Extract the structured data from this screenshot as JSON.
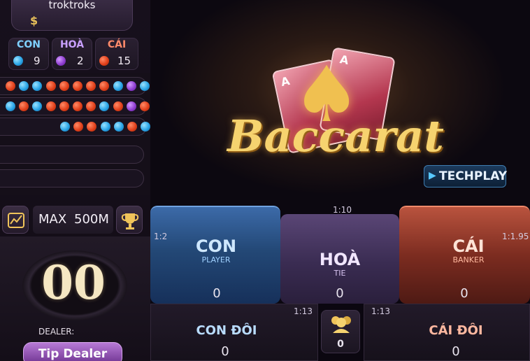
{
  "player": {
    "username": "troktroks",
    "currency_symbol": "$"
  },
  "stats": [
    {
      "label": "CON",
      "count": "9",
      "color": "#2aa5e7",
      "label_color": "#7fd0ff"
    },
    {
      "label": "HOÀ",
      "count": "2",
      "color": "#9140d2",
      "label_color": "#c9a0ff"
    },
    {
      "label": "CÁI",
      "count": "15",
      "color": "#e2411c",
      "label_color": "#ff8a6a"
    }
  ],
  "road": {
    "row1": [
      "red",
      "blue",
      "blue",
      "red",
      "red",
      "red",
      "red",
      "red",
      "blue",
      "purple",
      "blue"
    ],
    "row2": [
      "blue",
      "red",
      "blue",
      "red",
      "red",
      "red",
      "red",
      "blue",
      "red",
      "purple",
      "red"
    ],
    "row3": [
      "blue",
      "red",
      "red",
      "blue",
      "blue",
      "red",
      "blue"
    ]
  },
  "limits": {
    "max_label": "MAX",
    "max_value": "500M"
  },
  "timer": {
    "value": "00",
    "dealer_label": "DEALER:",
    "tip_button": "Tip Dealer"
  },
  "banner": {
    "logo": "Baccarat",
    "brand": "TECHPLAY",
    "card_letter": "A"
  },
  "bets": {
    "con": {
      "label": "CON",
      "sub": "PLAYER",
      "ratio": "1:2",
      "value": "0"
    },
    "hoa": {
      "label": "HOÀ",
      "sub": "TIE",
      "ratio": "1:10",
      "value": "0"
    },
    "cai": {
      "label": "CÁI",
      "sub": "BANKER",
      "ratio": "1:1.95",
      "value": "0"
    },
    "con_doi": {
      "label": "CON ĐÔI",
      "ratio": "1:13",
      "value": "0"
    },
    "cai_doi": {
      "label": "CÁI ĐÔI",
      "ratio": "1:13",
      "value": "0"
    },
    "players_count": "0"
  }
}
